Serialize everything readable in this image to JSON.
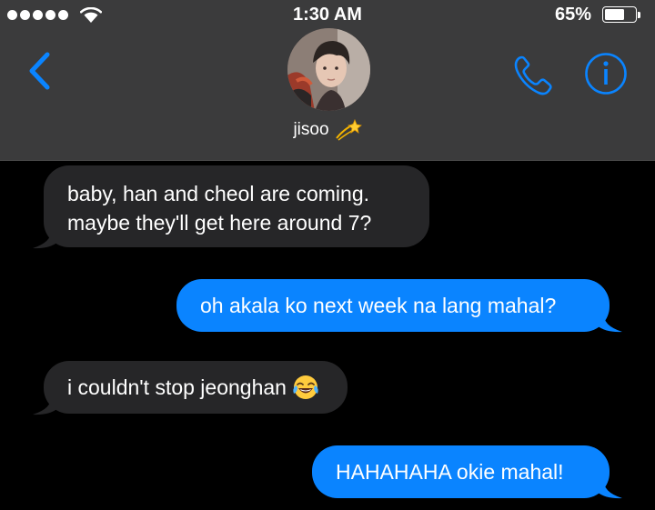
{
  "status_bar": {
    "time": "1:30 AM",
    "battery_percent": "65%",
    "battery_level": 0.65,
    "signal_bars": 5,
    "wifi_icon": "wifi-icon"
  },
  "header": {
    "contact_name": "jisoo",
    "contact_emoji": "dizzy-emoji",
    "back_icon": "chevron-left-icon",
    "call_icon": "phone-icon",
    "info_icon": "info-icon",
    "accent_color": "#0a84ff",
    "background_color": "#3b3b3c"
  },
  "messages": [
    {
      "direction": "received",
      "lines": [
        "baby, han and cheol are coming.",
        "maybe they'll get here around 7?"
      ]
    },
    {
      "direction": "sent",
      "text": "oh akala ko next week na lang mahal?"
    },
    {
      "direction": "received",
      "text": "i couldn't stop jeonghan",
      "emoji": "face-with-tears-of-joy-emoji"
    },
    {
      "direction": "sent",
      "text": "HAHAHAHA okie mahal!"
    }
  ],
  "colors": {
    "received_bubble": "#262628",
    "sent_bubble": "#0a84ff",
    "background": "#000000"
  }
}
